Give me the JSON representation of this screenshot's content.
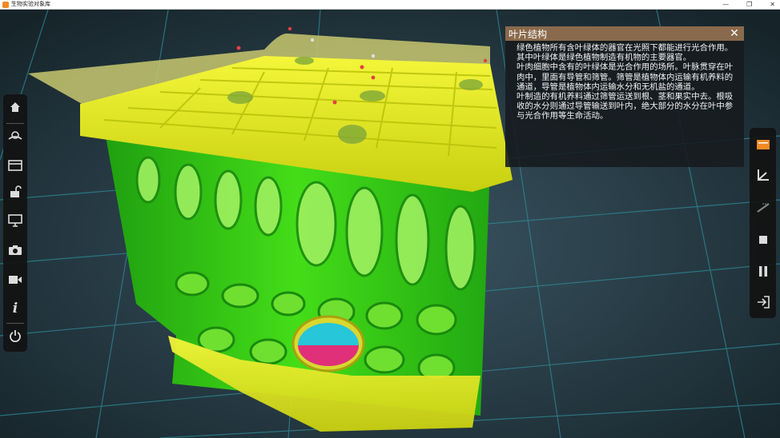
{
  "window": {
    "title": "生物实验对象库",
    "controls": {
      "minimize": "—",
      "maximize": "❐",
      "close": "✕"
    }
  },
  "left_toolbar": [
    {
      "name": "home-icon"
    },
    {
      "name": "object-library-icon"
    },
    {
      "name": "slides-icon"
    },
    {
      "name": "unlock-icon"
    },
    {
      "name": "monitor-icon"
    },
    {
      "name": "camera-icon"
    },
    {
      "name": "video-camera-icon"
    },
    {
      "name": "info-icon"
    },
    {
      "name": "power-icon"
    }
  ],
  "right_toolbar": [
    {
      "name": "panel-toggle-icon"
    },
    {
      "name": "axes-icon"
    },
    {
      "name": "ruler-icon"
    },
    {
      "name": "stop-icon"
    },
    {
      "name": "pause-icon"
    },
    {
      "name": "exit-icon"
    }
  ],
  "info_panel": {
    "title": "叶片结构",
    "close": "✕",
    "paragraphs": [
      "绿色植物所有含叶绿体的器官在光照下都能进行光合作用。其中叶绿体是绿色植物制造有机物的主要器官。",
      "叶肉细胞中含有的叶绿体是光合作用的场所。叶脉贯穿在叶肉中，里面有导管和筛管。筛管是植物体内运输有机养料的通道，导管是植物体内运输水分和无机盐的通道。",
      "叶制造的有机养料通过筛管运送到根、茎和果实中去。根吸收的水分则通过导管输送到叶内，绝大部分的水分在叶中参与光合作用等生命活动。"
    ]
  },
  "colors": {
    "accent": "#f08a24",
    "panel_header": "#8a6a4c",
    "epidermis": "#e8f020",
    "mesophyll": "#33cc10",
    "xylem": "#27c6d8",
    "phloem": "#e0307a"
  }
}
